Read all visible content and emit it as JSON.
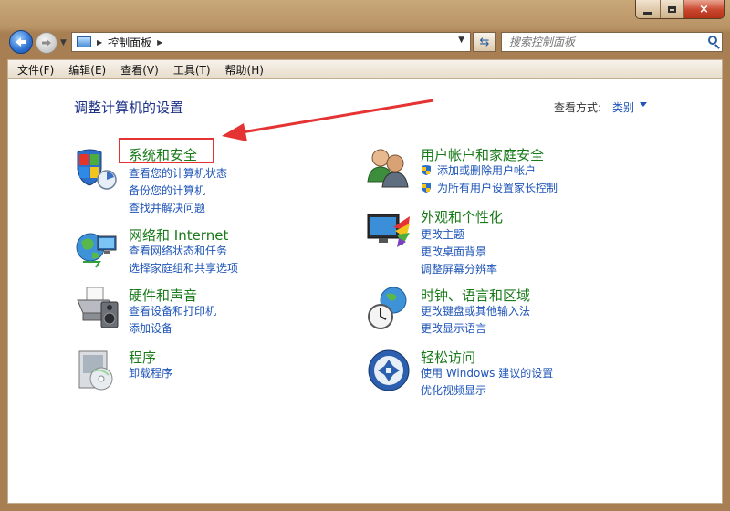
{
  "window": {
    "close_glyph": "×"
  },
  "nav": {
    "address_crumb": "控制面板",
    "search_placeholder": "搜索控制面板"
  },
  "menu": [
    "文件(F)",
    "编辑(E)",
    "查看(V)",
    "工具(T)",
    "帮助(H)"
  ],
  "page": {
    "title": "调整计算机的设置",
    "view_label": "查看方式:",
    "view_value": "类别"
  },
  "categories_left": [
    {
      "title": "系统和安全",
      "icon": "system-security-icon",
      "links": [
        "查看您的计算机状态",
        "备份您的计算机",
        "查找并解决问题"
      ]
    },
    {
      "title": "网络和 Internet",
      "icon": "network-globe-icon",
      "links": [
        "查看网络状态和任务",
        "选择家庭组和共享选项"
      ]
    },
    {
      "title": "硬件和声音",
      "icon": "printer-hardware-icon",
      "links": [
        "查看设备和打印机",
        "添加设备"
      ]
    },
    {
      "title": "程序",
      "icon": "programs-disc-icon",
      "links": [
        "卸载程序"
      ]
    }
  ],
  "categories_right": [
    {
      "title": "用户帐户和家庭安全",
      "icon": "user-accounts-icon",
      "links": [
        "添加或删除用户帐户",
        "为所有用户设置家长控制"
      ]
    },
    {
      "title": "外观和个性化",
      "icon": "appearance-monitor-icon",
      "links": [
        "更改主题",
        "更改桌面背景",
        "调整屏幕分辨率"
      ]
    },
    {
      "title": "时钟、语言和区域",
      "icon": "clock-globe-icon",
      "links": [
        "更改键盘或其他输入法",
        "更改显示语言"
      ]
    },
    {
      "title": "轻松访问",
      "icon": "ease-of-access-icon",
      "links": [
        "使用 Windows 建议的设置",
        "优化视频显示"
      ]
    }
  ],
  "colors": {
    "category_title": "#1a7a1a",
    "link": "#1f55b8",
    "page_title": "#1e3287",
    "annotation": "#e53232",
    "frame": "#b99466"
  }
}
